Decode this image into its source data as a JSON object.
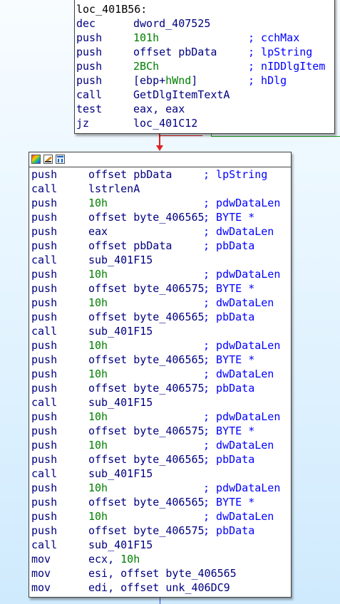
{
  "top_block": {
    "label": "loc_401B56:",
    "lines": [
      {
        "mnemonic": "dec",
        "operand": "dword_407525",
        "operand_type": "op",
        "comment": ""
      },
      {
        "mnemonic": "push",
        "operand": "101h",
        "operand_type": "num",
        "comment": "; cchMax"
      },
      {
        "mnemonic": "push",
        "operand": "offset pbData",
        "operand_type": "op",
        "comment": "; lpString"
      },
      {
        "mnemonic": "push",
        "operand": "2BCh",
        "operand_type": "num",
        "comment": "; nIDDlgItem"
      },
      {
        "mnemonic": "push",
        "operand_prefix": "[ebp+",
        "operand_highlight": "hWnd",
        "operand_suffix": "]",
        "operand_type": "mixed",
        "comment": "; hDlg"
      },
      {
        "mnemonic": "call",
        "operand": "GetDlgItemTextA",
        "operand_type": "op",
        "comment": ""
      },
      {
        "mnemonic": "test",
        "operand": "eax, eax",
        "operand_type": "op",
        "comment": ""
      },
      {
        "mnemonic": "jz",
        "operand": "loc_401C12",
        "operand_type": "op",
        "comment": ""
      }
    ]
  },
  "bottom_block": {
    "toolbar_icons": [
      "palette-icon",
      "edit-icon",
      "graph-icon"
    ],
    "lines": [
      {
        "mnemonic": "push",
        "operand": "offset pbData",
        "operand_type": "op",
        "comment": "; lpString"
      },
      {
        "mnemonic": "call",
        "operand": "lstrlenA",
        "operand_type": "op",
        "comment": ""
      },
      {
        "mnemonic": "push",
        "operand": "10h",
        "operand_type": "num",
        "comment": "; pdwDataLen"
      },
      {
        "mnemonic": "push",
        "operand": "offset byte_406565",
        "operand_type": "op",
        "comment": "; BYTE *"
      },
      {
        "mnemonic": "push",
        "operand": "eax",
        "operand_type": "op",
        "comment": "; dwDataLen"
      },
      {
        "mnemonic": "push",
        "operand": "offset pbData",
        "operand_type": "op",
        "comment": "; pbData"
      },
      {
        "mnemonic": "call",
        "operand": "sub_401F15",
        "operand_type": "op",
        "comment": ""
      },
      {
        "mnemonic": "push",
        "operand": "10h",
        "operand_type": "num",
        "comment": "; pdwDataLen"
      },
      {
        "mnemonic": "push",
        "operand": "offset byte_406575",
        "operand_type": "op",
        "comment": "; BYTE *"
      },
      {
        "mnemonic": "push",
        "operand": "10h",
        "operand_type": "num",
        "comment": "; dwDataLen"
      },
      {
        "mnemonic": "push",
        "operand": "offset byte_406565",
        "operand_type": "op",
        "comment": "; pbData"
      },
      {
        "mnemonic": "call",
        "operand": "sub_401F15",
        "operand_type": "op",
        "comment": ""
      },
      {
        "mnemonic": "push",
        "operand": "10h",
        "operand_type": "num",
        "comment": "; pdwDataLen"
      },
      {
        "mnemonic": "push",
        "operand": "offset byte_406565",
        "operand_type": "op",
        "comment": "; BYTE *"
      },
      {
        "mnemonic": "push",
        "operand": "10h",
        "operand_type": "num",
        "comment": "; dwDataLen"
      },
      {
        "mnemonic": "push",
        "operand": "offset byte_406575",
        "operand_type": "op",
        "comment": "; pbData"
      },
      {
        "mnemonic": "call",
        "operand": "sub_401F15",
        "operand_type": "op",
        "comment": ""
      },
      {
        "mnemonic": "push",
        "operand": "10h",
        "operand_type": "num",
        "comment": "; pdwDataLen"
      },
      {
        "mnemonic": "push",
        "operand": "offset byte_406575",
        "operand_type": "op",
        "comment": "; BYTE *"
      },
      {
        "mnemonic": "push",
        "operand": "10h",
        "operand_type": "num",
        "comment": "; dwDataLen"
      },
      {
        "mnemonic": "push",
        "operand": "offset byte_406565",
        "operand_type": "op",
        "comment": "; pbData"
      },
      {
        "mnemonic": "call",
        "operand": "sub_401F15",
        "operand_type": "op",
        "comment": ""
      },
      {
        "mnemonic": "push",
        "operand": "10h",
        "operand_type": "num",
        "comment": "; pdwDataLen"
      },
      {
        "mnemonic": "push",
        "operand": "offset byte_406565",
        "operand_type": "op",
        "comment": "; BYTE *"
      },
      {
        "mnemonic": "push",
        "operand": "10h",
        "operand_type": "num",
        "comment": "; dwDataLen"
      },
      {
        "mnemonic": "push",
        "operand": "offset byte_406575",
        "operand_type": "op",
        "comment": "; pbData"
      },
      {
        "mnemonic": "call",
        "operand": "sub_401F15",
        "operand_type": "op",
        "comment": ""
      },
      {
        "mnemonic": "mov",
        "operand_prefix": "ecx, ",
        "operand_highlight": "10h",
        "operand_suffix": "",
        "operand_type": "mixed",
        "comment": ""
      },
      {
        "mnemonic": "mov",
        "operand": "esi, offset byte_406565",
        "operand_type": "op",
        "comment": ""
      },
      {
        "mnemonic": "mov",
        "operand": "edi, offset unk_406DC9",
        "operand_type": "op",
        "comment": ""
      }
    ]
  },
  "colors": {
    "mnemonic": "#000080",
    "number": "#008000",
    "comment": "#0000ff",
    "false_branch": "#e02020",
    "true_branch": "#1aa01a"
  }
}
